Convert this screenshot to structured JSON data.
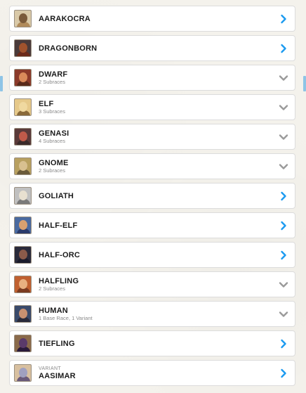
{
  "colors": {
    "accent": "#1b9af0",
    "collapsed_chevron": "#9a9a9a",
    "row_border": "#dcdcdc",
    "text": "#1b1b1b",
    "subtext": "#8a8a8a"
  },
  "races": [
    {
      "name": "AARAKOCRA",
      "sub": "",
      "pre": "",
      "chevron": "right",
      "icon": "aarakocra-portrait-icon"
    },
    {
      "name": "DRAGONBORN",
      "sub": "",
      "pre": "",
      "chevron": "right",
      "icon": "dragonborn-portrait-icon"
    },
    {
      "name": "DWARF",
      "sub": "2 Subraces",
      "pre": "",
      "chevron": "down",
      "icon": "dwarf-portrait-icon"
    },
    {
      "name": "ELF",
      "sub": "3 Subraces",
      "pre": "",
      "chevron": "down",
      "icon": "elf-portrait-icon"
    },
    {
      "name": "GENASI",
      "sub": "4 Subraces",
      "pre": "",
      "chevron": "down",
      "icon": "genasi-portrait-icon"
    },
    {
      "name": "GNOME",
      "sub": "2 Subraces",
      "pre": "",
      "chevron": "down",
      "icon": "gnome-portrait-icon"
    },
    {
      "name": "GOLIATH",
      "sub": "",
      "pre": "",
      "chevron": "right",
      "icon": "goliath-portrait-icon"
    },
    {
      "name": "HALF-ELF",
      "sub": "",
      "pre": "",
      "chevron": "right",
      "icon": "half-elf-portrait-icon"
    },
    {
      "name": "HALF-ORC",
      "sub": "",
      "pre": "",
      "chevron": "right",
      "icon": "half-orc-portrait-icon"
    },
    {
      "name": "HALFLING",
      "sub": "2 Subraces",
      "pre": "",
      "chevron": "down",
      "icon": "halfling-portrait-icon"
    },
    {
      "name": "HUMAN",
      "sub": "1 Base Race, 1 Variant",
      "pre": "",
      "chevron": "down",
      "icon": "human-portrait-icon"
    },
    {
      "name": "TIEFLING",
      "sub": "",
      "pre": "",
      "chevron": "right",
      "icon": "tiefling-portrait-icon"
    },
    {
      "name": "AASIMAR",
      "sub": "",
      "pre": "VARIANT",
      "chevron": "right",
      "icon": "aasimar-portrait-icon"
    }
  ]
}
